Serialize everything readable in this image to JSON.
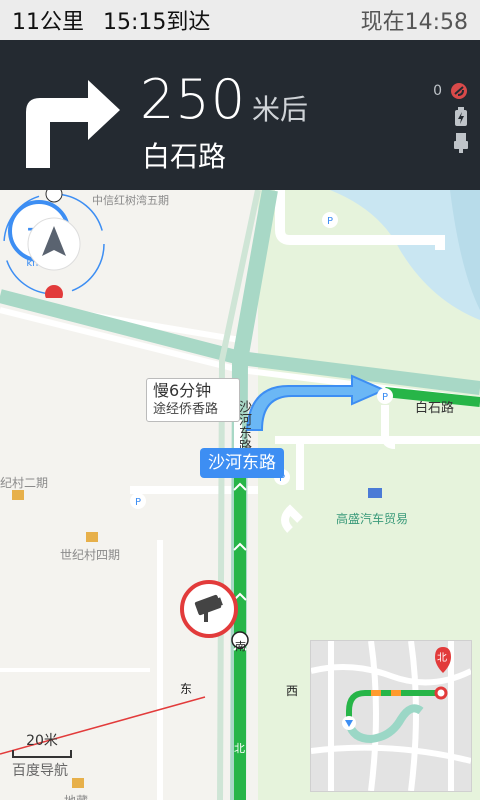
{
  "status": {
    "distance_left": "11公里",
    "arrive": "15:15到达",
    "now": "现在14:58"
  },
  "guidance": {
    "distance": "250",
    "unit": "米后",
    "road": "白石路",
    "camera_count": "0"
  },
  "speed": {
    "value": "— —",
    "unit": "km/h"
  },
  "map": {
    "slow_tip_line1": "慢6分钟",
    "slow_tip_line2": "途经侨香路",
    "current_road": "沙河东路",
    "labels": {
      "top": "中信红树湾五期",
      "road_baishi": "白石路",
      "road_shahe_vertical": "沙河东路",
      "village2": "纪村二期",
      "village4": "世纪村四期",
      "gaosheng": "高盛汽车贸易",
      "bottom_poi": "地藏"
    },
    "compass": {
      "n": "南",
      "e": "东",
      "w": "西",
      "s": "北"
    },
    "scale_label": "20米",
    "brand": "百度导航",
    "overview_north": "北"
  },
  "colors": {
    "primary_blue": "#3d8ef3",
    "traffic_green": "#27b548",
    "alert_red": "#e23b3b",
    "panel_dark": "#242a31"
  }
}
